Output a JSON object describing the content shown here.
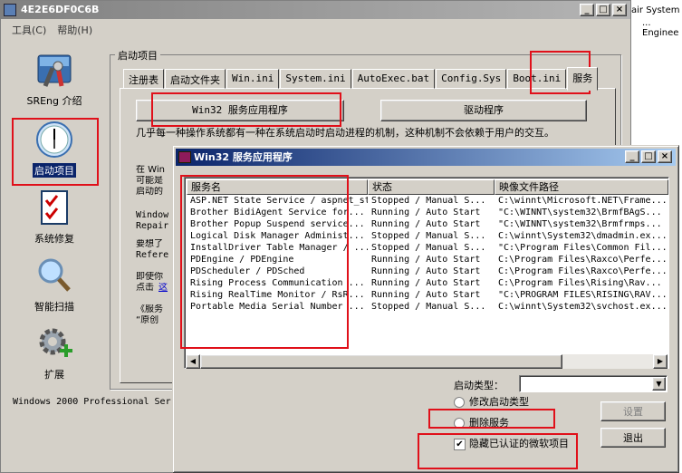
{
  "main": {
    "title": "4E2E6DF0C6B",
    "menu": [
      "工具(C)",
      "帮助(H)"
    ],
    "nav": [
      {
        "label": "SREng 介绍",
        "icon": "tools-icon"
      },
      {
        "label": "启动项目",
        "icon": "clock-icon"
      },
      {
        "label": "系统修复",
        "icon": "checklist-icon"
      },
      {
        "label": "智能扫描",
        "icon": "magnifier-icon"
      },
      {
        "label": "扩展",
        "icon": "gear-plus-icon"
      }
    ],
    "group_label": "启动项目",
    "tabs": [
      "注册表",
      "启动文件夹",
      "Win.ini",
      "System.ini",
      "AutoExec.bat",
      "Config.Sys",
      "Boot.ini",
      "服务"
    ],
    "btn_win32": "Win32 服务应用程序",
    "btn_driver": "驱动程序",
    "description": "几乎每一种操作系统都有一种在系统启动时启动进程的机制，这种机制不会依赖于用户的交互。",
    "partial_lines": [
      "在 Win",
      "可能是",
      "启动的",
      "Window",
      "Repair",
      "要想了",
      "Refere",
      "即使你",
      "点击",
      "这",
      "《服务",
      "“原创"
    ],
    "status": "Windows 2000 Professional Ser"
  },
  "strip": {
    "line1": "air System",
    "line2": "... Enginee"
  },
  "dialog": {
    "title": "Win32 服务应用程序",
    "columns": [
      "服务名",
      "状态",
      "映像文件路径"
    ],
    "rows": [
      [
        "ASP.NET State Service / aspnet_state",
        "Stopped / Manual S...",
        "C:\\winnt\\Microsoft.NET\\Frame..."
      ],
      [
        "Brother BidiAgent Service for...",
        "Running / Auto Start",
        "\"C:\\WINNT\\system32\\BrmfBAgS..."
      ],
      [
        "Brother Popup Suspend service...",
        "Running / Auto Start",
        "\"C:\\WINNT\\system32\\Brmfrmps..."
      ],
      [
        "Logical Disk Manager Administ...",
        "Stopped / Manual S...",
        "C:\\winnt\\System32\\dmadmin.ex..."
      ],
      [
        "InstallDriver Table Manager / ...",
        "Stopped / Manual S...",
        "\"C:\\Program Files\\Common Fil..."
      ],
      [
        "PDEngine / PDEngine",
        "Running / Auto Start",
        "C:\\Program Files\\Raxco\\Perfe..."
      ],
      [
        "PDScheduler / PDSched",
        "Running / Auto Start",
        "C:\\Program Files\\Raxco\\Perfe..."
      ],
      [
        "Rising Process Communication ...",
        "Running / Auto Start",
        "C:\\Program Files\\Rising\\Rav..."
      ],
      [
        "Rising RealTime Monitor / RsR...",
        "Running / Auto Start",
        "\"C:\\PROGRAM FILES\\RISING\\RAV..."
      ],
      [
        "Portable Media Serial Number ...",
        "Stopped / Manual S...",
        "C:\\winnt\\System32\\svchost.ex..."
      ]
    ],
    "startup_type_label": "启动类型：",
    "startup_type_value": "",
    "radio_modify": "修改启动类型",
    "radio_delete": "删除服务",
    "checkbox_hide_ms": "隐藏已认证的微软项目",
    "btn_set": "设置",
    "btn_exit": "退出"
  }
}
